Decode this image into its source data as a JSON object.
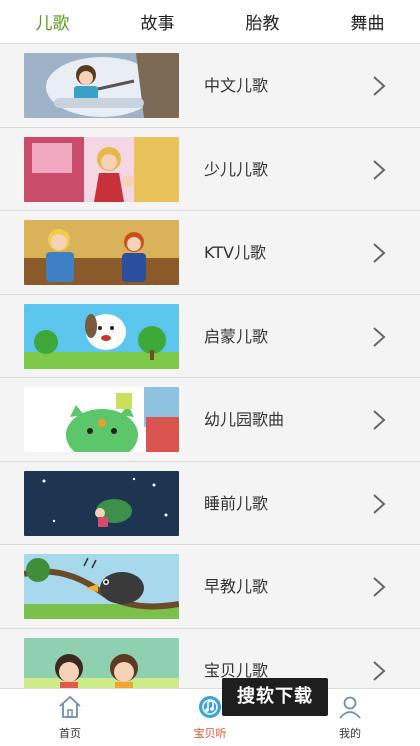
{
  "tabs": [
    {
      "label": "儿歌",
      "active": true
    },
    {
      "label": "故事",
      "active": false
    },
    {
      "label": "胎教",
      "active": false
    },
    {
      "label": "舞曲",
      "active": false
    }
  ],
  "categories": [
    {
      "label": "中文儿歌"
    },
    {
      "label": "少儿儿歌"
    },
    {
      "label": "KTV儿歌"
    },
    {
      "label": "启蒙儿歌"
    },
    {
      "label": "幼儿园歌曲"
    },
    {
      "label": "睡前儿歌"
    },
    {
      "label": "早教儿歌"
    },
    {
      "label": "宝贝儿歌"
    }
  ],
  "bottom_nav": [
    {
      "label": "首页",
      "icon": "home-icon"
    },
    {
      "label": "宝贝听",
      "icon": "music-disc-icon",
      "active": true
    },
    {
      "label": "我的",
      "icon": "profile-icon"
    }
  ],
  "watermark": "搜软下载",
  "colors": {
    "active_tab": "#5a9e1e",
    "active_nav": "#e0502c"
  }
}
